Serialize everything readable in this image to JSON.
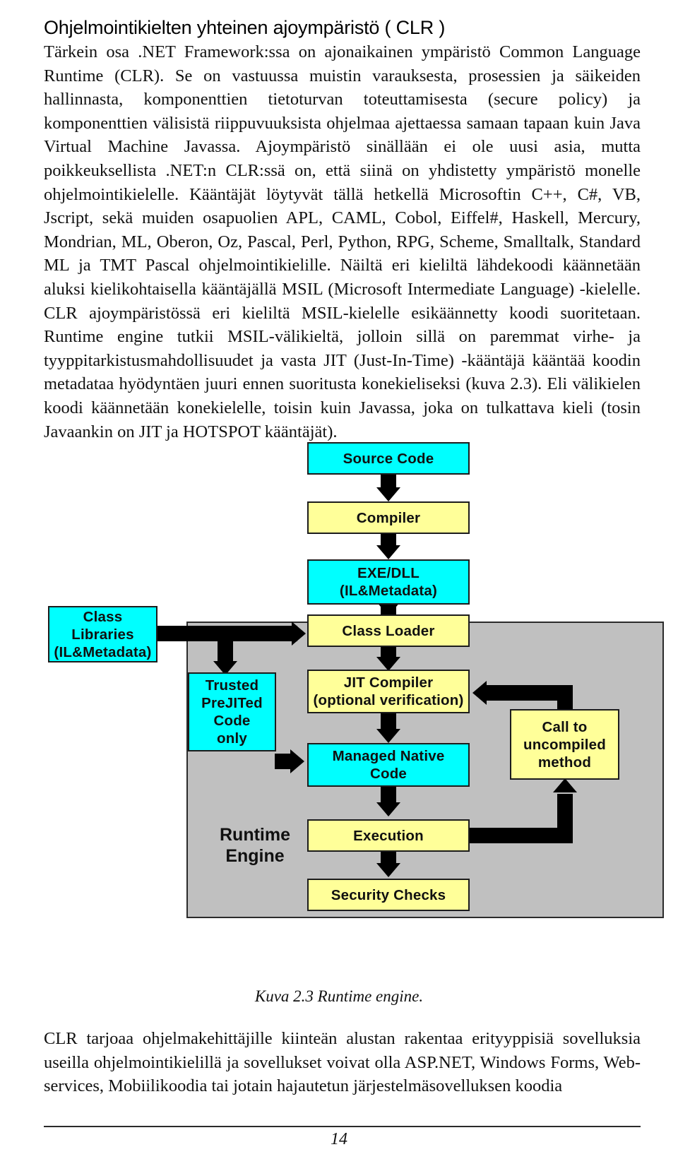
{
  "document": {
    "heading": "Ohjelmointikielten yhteinen ajoympäristö ( CLR )",
    "intro_paragraph": "Tärkein osa .NET Framework:ssa on ajonaikainen ympäristö Common Language Runtime (CLR). Se on vastuussa muistin varauksesta, prosessien ja säikeiden hallinnasta, komponenttien tietoturvan toteuttamisesta (secure policy) ja komponenttien välisistä riippuvuuksista ohjelmaa ajettaessa samaan tapaan kuin Java Virtual Machine Javassa. Ajoympäristö sinällään ei ole uusi asia, mutta poikkeuksellista .NET:n CLR:ssä on, että siinä on yhdistetty ympäristö monelle ohjelmointikielelle. Kääntäjät löytyvät tällä hetkellä Microsoftin C++, C#, VB, Jscript, sekä muiden osapuolien APL, CAML, Cobol, Eiffel#, Haskell, Mercury, Mondrian, ML, Oberon, Oz, Pascal, Perl, Python, RPG, Scheme, Smalltalk, Standard ML ja TMT Pascal ohjelmointikielille. Näiltä eri kieliltä lähdekoodi käännetään aluksi kielikohtaisella kääntäjällä MSIL (Microsoft Intermediate Language) -kielelle. CLR ajoympäristössä eri kieliltä MSIL-kielelle esikäännetty koodi suoritetaan. Runtime engine tutkii MSIL-välikieltä, jolloin sillä on paremmat virhe- ja tyyppitarkistusmahdollisuudet ja vasta JIT (Just-In-Time) -kääntäjä kääntää koodin metadataa hyödyntäen juuri ennen suoritusta konekieliseksi (kuva 2.3). Eli välikielen koodi käännetään konekielelle, toisin kuin Javassa, joka on tulkattava kieli (tosin Javaankin on JIT ja HOTSPOT kääntäjät).",
    "closing_paragraph": "CLR tarjoaa ohjelmakehittäjille kiinteän alustan rakentaa erityyppisiä sovelluksia useilla ohjelmointikielillä ja sovellukset voivat olla ASP.NET, Windows Forms, Web-services, Mobiilikoodia tai jotain hajautetun järjestelmäsovelluksen koodia",
    "page_number": "14"
  },
  "figure": {
    "caption": "Kuva 2.3 Runtime engine.",
    "panel_label": "Runtime\nEngine",
    "colors": {
      "cyan": "#00ffff",
      "yellow": "#ffff99",
      "panel_gray": "#c0c0c0",
      "border": "#1c1c1c",
      "arrow": "#000000"
    },
    "nodes": [
      {
        "id": "source-code",
        "label": "Source Code",
        "fill": "cyan"
      },
      {
        "id": "compiler",
        "label": "Compiler",
        "fill": "yellow"
      },
      {
        "id": "exe-dll",
        "label": "EXE/DLL\n(IL&Metadata)",
        "fill": "cyan"
      },
      {
        "id": "class-libraries",
        "label": "Class\nLibraries\n(IL&Metadata)",
        "fill": "cyan"
      },
      {
        "id": "class-loader",
        "label": "Class Loader",
        "fill": "yellow"
      },
      {
        "id": "trusted-prejit",
        "label": "Trusted\nPreJITed\nCode\nonly",
        "fill": "cyan"
      },
      {
        "id": "jit-compiler",
        "label": "JIT Compiler\n(optional verification)",
        "fill": "yellow"
      },
      {
        "id": "call-uncompiled",
        "label": "Call to\nuncompiled\nmethod",
        "fill": "yellow"
      },
      {
        "id": "managed-native",
        "label": "Managed Native\nCode",
        "fill": "cyan"
      },
      {
        "id": "execution",
        "label": "Execution",
        "fill": "yellow"
      },
      {
        "id": "security-checks",
        "label": "Security Checks",
        "fill": "yellow"
      }
    ],
    "edges": [
      {
        "from": "source-code",
        "to": "compiler",
        "direction": "down"
      },
      {
        "from": "compiler",
        "to": "exe-dll",
        "direction": "down"
      },
      {
        "from": "exe-dll",
        "to": "class-loader",
        "direction": "down"
      },
      {
        "from": "class-libraries",
        "to": "class-loader",
        "direction": "right"
      },
      {
        "from": "class-libraries",
        "to": "trusted-prejit",
        "direction": "down"
      },
      {
        "from": "class-loader",
        "to": "jit-compiler",
        "direction": "down"
      },
      {
        "from": "jit-compiler",
        "to": "managed-native",
        "direction": "down"
      },
      {
        "from": "trusted-prejit",
        "to": "managed-native",
        "direction": "right"
      },
      {
        "from": "call-uncompiled",
        "to": "jit-compiler",
        "direction": "left"
      },
      {
        "from": "managed-native",
        "to": "execution",
        "direction": "down"
      },
      {
        "from": "execution",
        "to": "call-uncompiled",
        "direction": "up"
      },
      {
        "from": "execution",
        "to": "security-checks",
        "direction": "down"
      }
    ]
  }
}
